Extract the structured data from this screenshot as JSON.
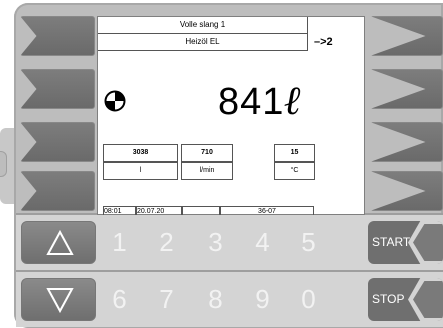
{
  "header": {
    "line1": "Volle slang 1",
    "line2": "Heizöl EL",
    "step": "–>2"
  },
  "main": {
    "volume": "841",
    "unit": "ℓ"
  },
  "readings": [
    {
      "value": "3038",
      "unit": "l"
    },
    {
      "value": "710",
      "unit": "l/min"
    },
    {
      "value": "15",
      "unit": "°C"
    }
  ],
  "status": {
    "time": "08:01",
    "date": "20.07.20",
    "blank": "",
    "code": "36-07"
  },
  "keypad": {
    "row1": [
      "1",
      "2",
      "3",
      "4",
      "5"
    ],
    "row2": [
      "6",
      "7",
      "8",
      "9",
      "0"
    ],
    "start": "START",
    "stop": "STOP"
  },
  "icons": {
    "logo": "quartered-circle-icon",
    "up": "triangle-up-icon",
    "down": "triangle-down-icon"
  }
}
